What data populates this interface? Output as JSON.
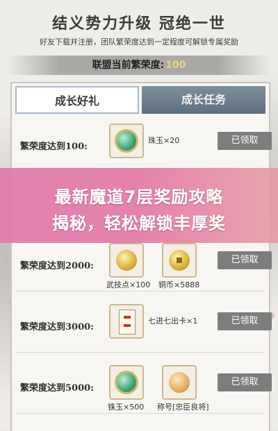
{
  "header": {
    "title": "结义势力升级 冠绝一世",
    "subtitle": "好友下载并注册，团队繁荣度达到一定程度可解锁专属奖励",
    "prosperity_label": "联盟当前繁荣度:",
    "prosperity_value": "100"
  },
  "tabs": [
    {
      "label": "成长好礼",
      "active": true
    },
    {
      "label": "成长任务",
      "active": false
    }
  ],
  "rows": [
    {
      "label": "繁荣度达到100:",
      "items": [
        {
          "icon": "jade-icon",
          "caption": "珠玉×20"
        }
      ],
      "button": "已领取"
    },
    {
      "label": "繁荣度达到2000:",
      "items": [
        {
          "icon": "martial-point-icon",
          "caption": "武技点×100"
        },
        {
          "icon": "copper-coin-icon",
          "caption": "铜币×5888"
        }
      ],
      "button": "已领取"
    },
    {
      "label": "繁荣度达到3000:",
      "items": [
        {
          "icon": "card-icon",
          "caption": "七进七出卡×1"
        }
      ],
      "button": "已领取"
    },
    {
      "label": "繁荣度达到5000:",
      "items": [
        {
          "icon": "jade-icon",
          "caption": "铢玉×500"
        },
        {
          "icon": "title-medal-icon",
          "caption": "称号[忠臣良将]"
        }
      ],
      "button": "已领取"
    }
  ],
  "banner": {
    "line1": "最新魔道7层奖励攻略",
    "line2": "揭秘，轻松解锁丰厚奖"
  },
  "colors": {
    "banner": "#e27aaa",
    "button": "#7d7d7d",
    "prosperity_value": "#f0d37a",
    "tab_active_border": "#a7b6c6",
    "tab_inactive": "#6b7d8c"
  }
}
